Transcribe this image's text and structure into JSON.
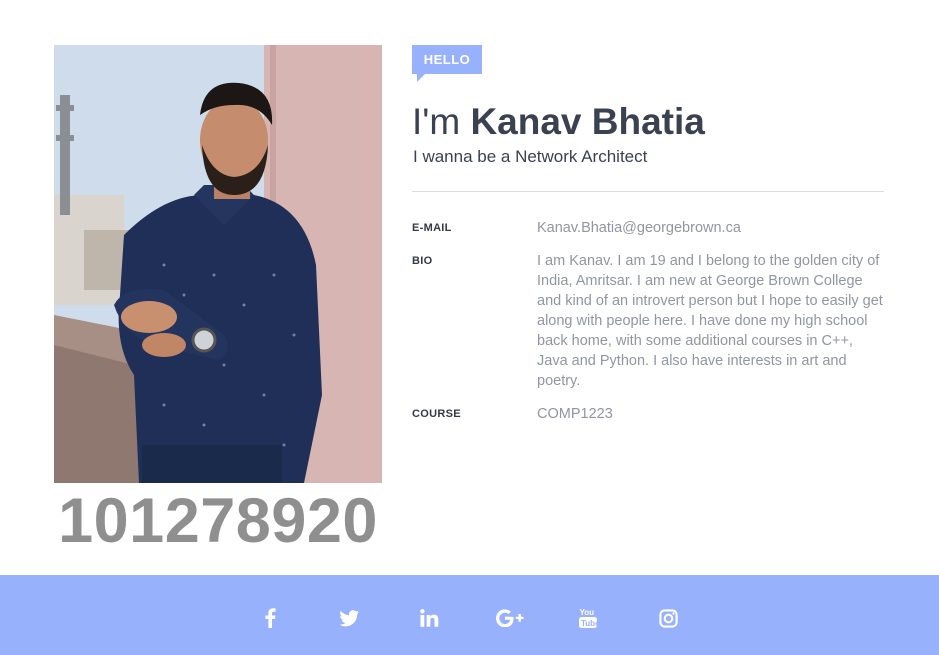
{
  "profile": {
    "student_id": "101278920",
    "badge": "HELLO",
    "greeting": "I'm",
    "name": "Kanav Bhatia",
    "tagline": "I wanna be a Network Architect"
  },
  "details": [
    {
      "label": "E-MAIL",
      "value": "Kanav.Bhatia@georgebrown.ca"
    },
    {
      "label": "BIO",
      "value": "I am Kanav. I am 19 and I belong to the golden city of India, Amritsar. I am new at George Brown College and kind of an introvert person but I hope to easily get along with people here. I have done my high school back home, with some additional courses in C++, Java and Python. I also have interests in art and poetry."
    },
    {
      "label": "COURSE",
      "value": "COMP1223"
    }
  ],
  "social": [
    "facebook-icon",
    "twitter-icon",
    "linkedin-icon",
    "google-plus-icon",
    "youtube-icon",
    "instagram-icon"
  ],
  "colors": {
    "accent": "#98b1fc",
    "heading": "#3a4150",
    "muted": "#9096a0",
    "id_text": "#8f8f8f"
  }
}
